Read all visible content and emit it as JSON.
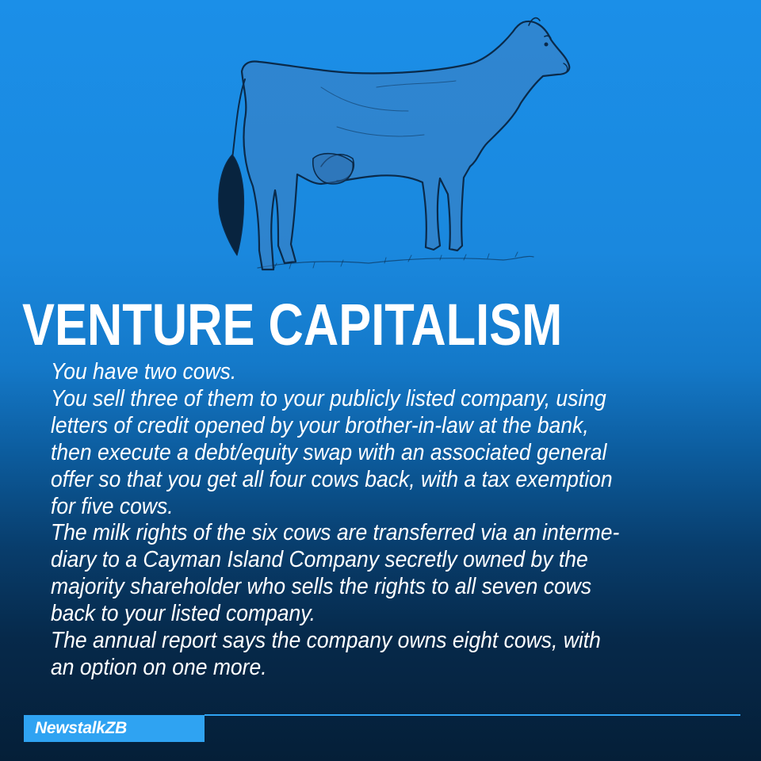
{
  "headline": "VENTURE CAPITALISM",
  "body_lines": [
    "You have two cows.",
    "You sell three of them to your publicly listed company, using",
    "letters of credit opened by your brother-in-law at the bank,",
    "then execute a debt/equity swap with an associated general",
    "offer so that you get all four cows back, with a tax exemption",
    "for five cows.",
    "The milk rights of the six cows are transferred via an interme-",
    "diary to a Cayman Island Company secretly owned by the",
    "majority shareholder who sells the rights to all seven cows",
    "back to your listed company.",
    "The annual report says the company owns eight cows, with",
    "an option on one more."
  ],
  "logo": {
    "text": "NewstalkZB"
  },
  "colors": {
    "background_top": "#1b8fe8",
    "background_bottom": "#051f38",
    "text": "#ffffff",
    "logo_accent": "#2fa3f2",
    "illustration_ink": "#0a2a4a"
  },
  "illustration": "cow-sketch"
}
